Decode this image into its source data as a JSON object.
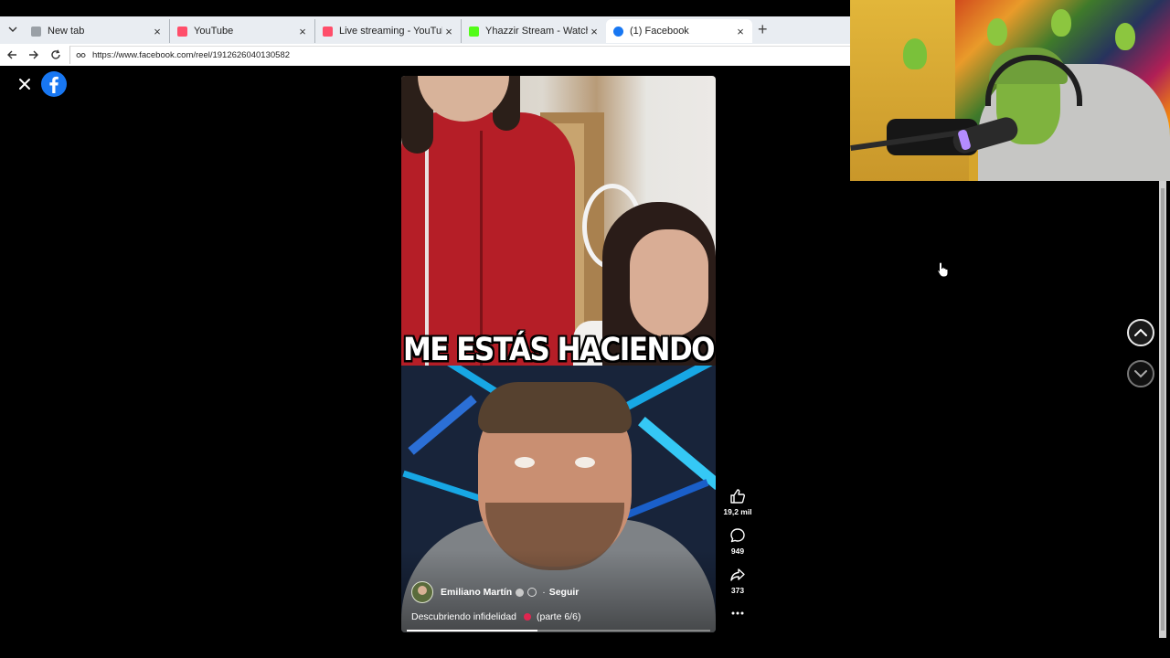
{
  "browser": {
    "tabs": [
      {
        "title": "New tab",
        "favicon_color": "#9aa0a6"
      },
      {
        "title": "YouTube",
        "favicon_color": "#ff4e6a"
      },
      {
        "title": "Live streaming - YouTube Studio",
        "favicon_color": "#ff4e6a"
      },
      {
        "title": "Yhazzir Stream - Watch Live on Kick",
        "favicon_color": "#53fc18"
      },
      {
        "title": "(1) Facebook",
        "favicon_color": "#1877f2"
      }
    ],
    "active_tab_index": 4,
    "url": "https://www.facebook.com/reel/1912626040130582"
  },
  "reel": {
    "caption_overlay": "ME ESTÁS HACIENDO",
    "author_name": "Emiliano Martín",
    "separator": "·",
    "follow_label": "Seguir",
    "description": "Descubriendo infidelidad",
    "part_label": "(parte 6/6)",
    "progress": 0.43,
    "actions": {
      "likes": "19,2 mil",
      "comments": "949",
      "shares": "373"
    }
  },
  "colors": {
    "facebook_blue": "#1877f2",
    "page_bg": "#000000",
    "accent_heart": "#e02650"
  },
  "icons": [
    "close-icon",
    "facebook-logo-icon",
    "like-icon",
    "comment-icon",
    "share-icon",
    "more-icon",
    "chevron-up-icon",
    "chevron-down-icon",
    "lock-icon",
    "back-icon",
    "forward-icon",
    "reload-icon"
  ]
}
